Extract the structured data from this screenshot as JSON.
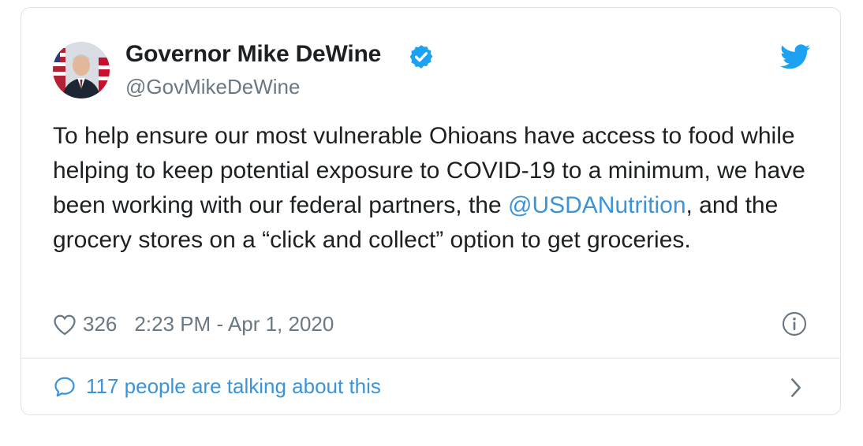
{
  "author": {
    "name": "Governor Mike DeWine",
    "handle": "@GovMikeDeWine",
    "verified": true
  },
  "tweet": {
    "text_before": "To help ensure our most vulnerable Ohioans have access to food while helping to keep potential exposure to COVID-19 to a minimum, we have been working with our federal partners, the ",
    "mention": "@USDANutrition",
    "text_after": ", and the grocery stores on a “click and collect” option to get groceries."
  },
  "meta": {
    "like_count": "326",
    "timestamp": "2:23 PM - Apr 1, 2020"
  },
  "footer": {
    "talking_label": "117 people are talking about this"
  },
  "colors": {
    "link": "#3b94d9",
    "muted": "#697882",
    "border": "#dfe4e8",
    "verified": "#1da1f2"
  },
  "icons": [
    "avatar-photo",
    "verified-badge-icon",
    "twitter-bird-icon",
    "heart-icon",
    "info-icon",
    "speech-bubble-icon",
    "chevron-right-icon"
  ]
}
